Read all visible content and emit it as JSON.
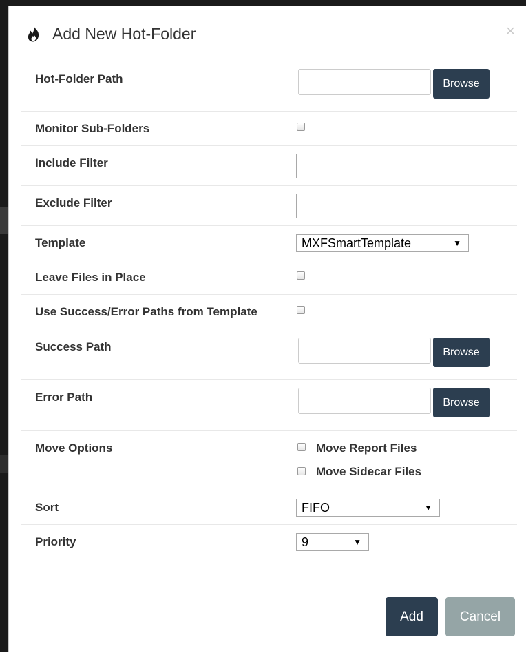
{
  "dialog": {
    "title": "Add New Hot-Folder",
    "close_symbol": "×",
    "title_icon": "fire-icon"
  },
  "form": {
    "hot_folder_path": {
      "label": "Hot-Folder Path",
      "value": "",
      "browse_label": "Browse"
    },
    "monitor_sub_folders": {
      "label": "Monitor Sub-Folders",
      "checked": false
    },
    "include_filter": {
      "label": "Include Filter",
      "value": ""
    },
    "exclude_filter": {
      "label": "Exclude Filter",
      "value": ""
    },
    "template": {
      "label": "Template",
      "selected": "MXFSmartTemplate"
    },
    "leave_files_in_place": {
      "label": "Leave Files in Place",
      "checked": false
    },
    "use_template_paths": {
      "label": "Use Success/Error Paths from Template",
      "checked": false
    },
    "success_path": {
      "label": "Success Path",
      "value": "",
      "browse_label": "Browse"
    },
    "error_path": {
      "label": "Error Path",
      "value": "",
      "browse_label": "Browse"
    },
    "move_options": {
      "label": "Move Options",
      "report_files_label": "Move Report Files",
      "sidecar_files_label": "Move Sidecar Files",
      "report_checked": false,
      "sidecar_checked": false
    },
    "sort": {
      "label": "Sort",
      "selected": "FIFO"
    },
    "priority": {
      "label": "Priority",
      "selected": "9"
    }
  },
  "footer": {
    "add_label": "Add",
    "cancel_label": "Cancel"
  },
  "colors": {
    "primary": "#2c3e50",
    "secondary": "#95a5a6"
  }
}
